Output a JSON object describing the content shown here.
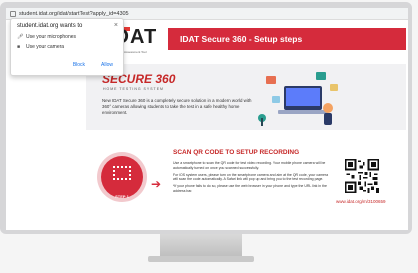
{
  "browser": {
    "url": "student.idat.org/idat/startTest?apply_id=4305"
  },
  "permission_popup": {
    "title": "student.idat.org wants to",
    "items": [
      {
        "icon": "microphone-icon",
        "label": "Use your microphones"
      },
      {
        "icon": "camera-icon",
        "label": "Use your camera"
      }
    ],
    "block_label": "Block",
    "allow_label": "Allow",
    "close": "×"
  },
  "header": {
    "logo": "IDAT",
    "logo_tagline": "Assessment Tool",
    "title": "IDAT Secure 360 - Setup steps"
  },
  "hero": {
    "brand": "SECURE 360",
    "brand_sub": "HOME TESTING SYSTEM",
    "description": "New IDAT Secure 360 is a completely secure solution in a modern world with 360° cameras allowing students to take the test in a safe healthy home environment."
  },
  "step": {
    "label": "STEP 1",
    "heading": "SCAN QR CODE TO SETUP RECORDING",
    "paragraphs": [
      "Use a smartphone to scan the QR code for test video recording. Your mobile phone camera will be automatically turned on once you scanned successfully.",
      "For iOS system users, please turn on the smartphone camera and aim at the QR code, your camera will scan the code automatically. A Safari link will pop up and bring you to the test recording page.",
      "*If your phone fails to do so, please use the web browser in your phone and type the URL link in the address bar."
    ],
    "qr_link": "www.idat.org/m/3100659"
  },
  "colors": {
    "accent": "#d52b3c",
    "brand_red": "#c62828",
    "link_blue": "#1a73e8"
  }
}
